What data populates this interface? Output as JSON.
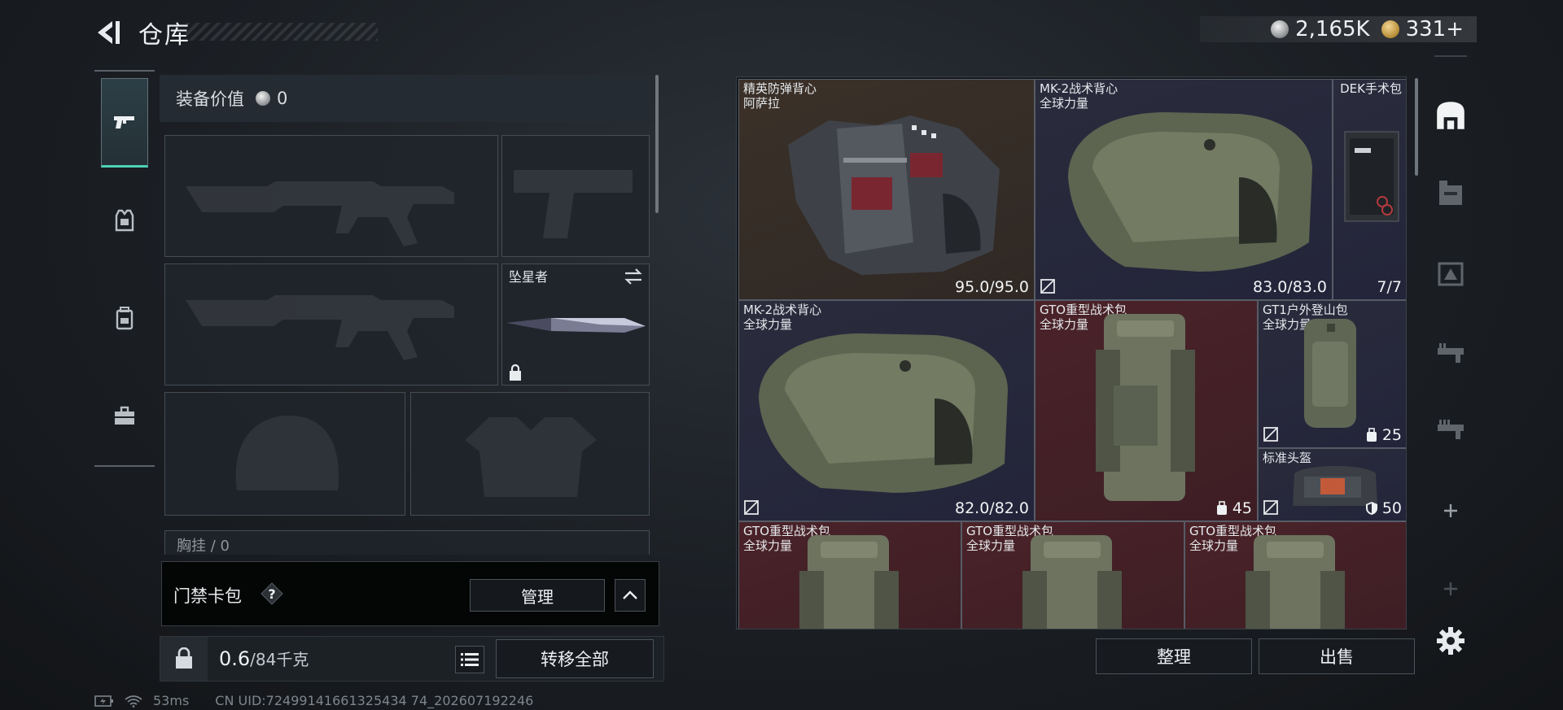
{
  "header": {
    "title": "仓库",
    "currencies": [
      {
        "name": "silver-coin",
        "value": "2,165K"
      },
      {
        "name": "gold-coin",
        "value": "331+"
      }
    ]
  },
  "categories": [
    {
      "icon": "pistol-icon",
      "active": true
    },
    {
      "icon": "armor-vest-icon",
      "active": false
    },
    {
      "icon": "backpack-icon",
      "active": false
    },
    {
      "icon": "toolbox-icon",
      "active": false
    }
  ],
  "equipment": {
    "value_label": "装备价值",
    "value": "0",
    "melee_slot_label": "坠星者",
    "chest_rig_label": "胸挂 / 0"
  },
  "keycard": {
    "label": "门禁卡包",
    "help": "?",
    "manage_label": "管理"
  },
  "capacity": {
    "current": "0.6",
    "max": "/84千克"
  },
  "transfer_all_label": "转移全部",
  "status": {
    "ping": "53ms",
    "uid": "CN UID:72499141661325434 74_202607192246"
  },
  "inventory": {
    "items": [
      {
        "name": "精英防弹背心",
        "sub": "阿萨拉",
        "durability": "95.0/95.0",
        "color": "brown"
      },
      {
        "name": "MK-2战术背心",
        "sub": "全球力量",
        "durability": "83.0/83.0",
        "color": "purple"
      },
      {
        "name": "DEK手术包",
        "sub": "",
        "durability": "7/7",
        "color": "purple"
      },
      {
        "name": "MK-2战术背心",
        "sub": "全球力量",
        "durability": "82.0/82.0",
        "color": "purple"
      },
      {
        "name": "GTO重型战术包",
        "sub": "全球力量",
        "capacity": "45",
        "color": "red"
      },
      {
        "name": "GT1户外登山包",
        "sub": "全球力量",
        "capacity": "25",
        "color": "purple"
      },
      {
        "name": "标准头盔",
        "sub": "",
        "armor": "50",
        "color": "purple"
      },
      {
        "name": "GTO重型战术包",
        "sub": "全球力量",
        "color": "red"
      },
      {
        "name": "GTO重型战术包",
        "sub": "全球力量",
        "color": "red"
      },
      {
        "name": "GTO重型战术包",
        "sub": "全球力量",
        "color": "red"
      }
    ],
    "sort_label": "整理",
    "sell_label": "出售"
  },
  "right_tabs": [
    {
      "icon": "warehouse-home-icon",
      "active": true
    },
    {
      "icon": "storage-box-icon",
      "active": false
    },
    {
      "icon": "equipment-crate-icon",
      "active": false
    },
    {
      "icon": "weapon-rack-icon",
      "active": false
    },
    {
      "icon": "weapon-rack-2-icon",
      "active": false
    },
    {
      "icon": "add-icon",
      "active": false
    },
    {
      "icon": "add-disabled-icon",
      "active": false
    },
    {
      "icon": "settings-gear-icon",
      "active": false
    }
  ],
  "colors": {
    "accent": "#4fd0b7",
    "cell_brown": "#3b3129",
    "cell_purple": "#2a2c3c",
    "cell_red": "#4a2329"
  }
}
